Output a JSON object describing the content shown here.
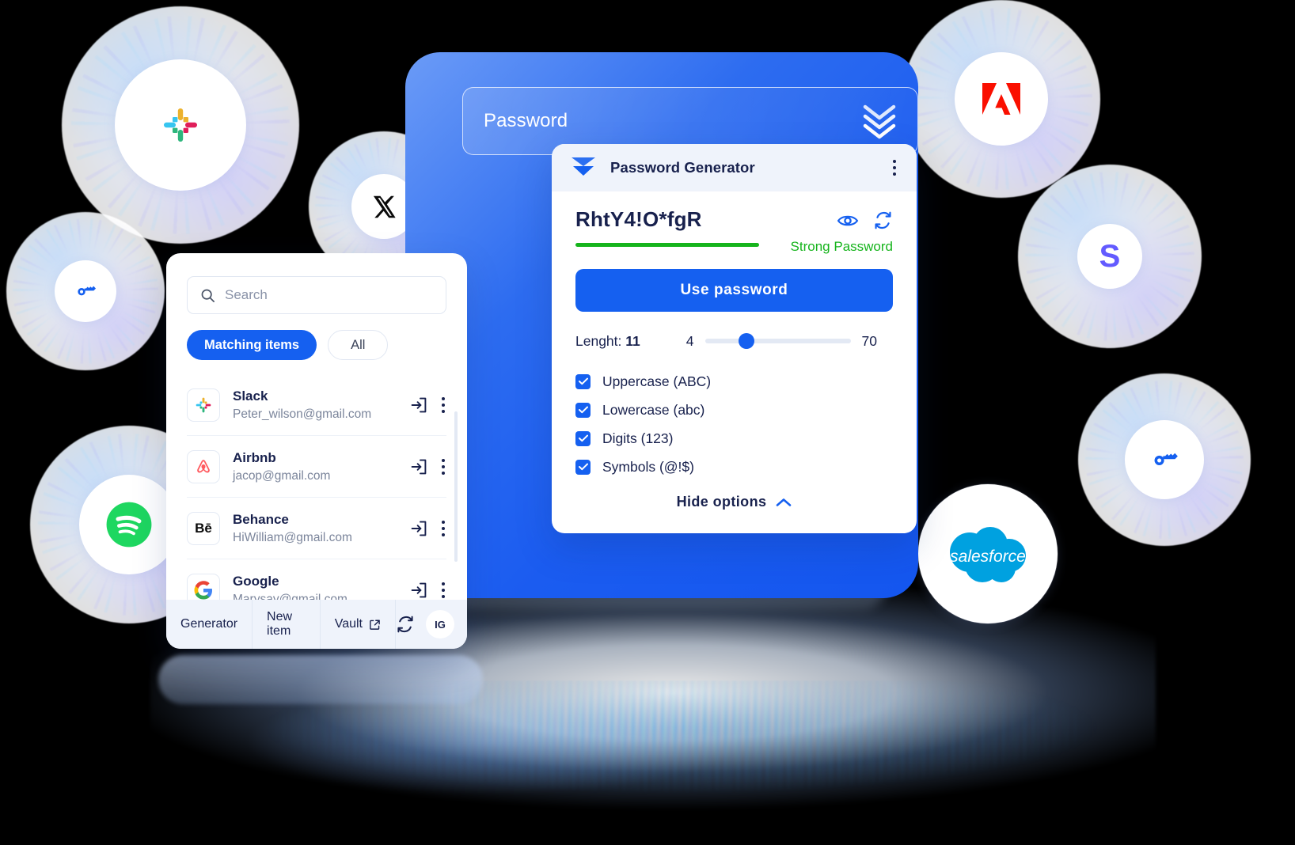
{
  "blue_card": {
    "password_field": {
      "label": "Password",
      "icon": "chevron-double-down-icon"
    }
  },
  "generator": {
    "header": {
      "title": "Password Generator",
      "logo_icon": "chevron-double-down-icon",
      "menu_icon": "kebab-menu-icon"
    },
    "password_value": "RhtY4!O*fgR",
    "strength_label": "Strong Password",
    "strength_color": "#16b41c",
    "reveal_icon": "eye-icon",
    "regenerate_icon": "refresh-icon",
    "use_password_label": "Use  password",
    "length": {
      "label": "Lenght:",
      "value": "11",
      "min": "4",
      "max": "70"
    },
    "options": [
      {
        "label": "Uppercase (ABC)",
        "checked": true
      },
      {
        "label": "Lowercase (abc)",
        "checked": true
      },
      {
        "label": "Digits (123)",
        "checked": true
      },
      {
        "label": "Symbols (@!$)",
        "checked": true
      }
    ],
    "hide_options_label": "Hide  options",
    "hide_options_icon": "chevron-up-icon"
  },
  "vault": {
    "search": {
      "placeholder": "Search",
      "icon": "search-icon"
    },
    "filters": [
      {
        "label": "Matching items",
        "active": true
      },
      {
        "label": "All",
        "active": false
      }
    ],
    "items": [
      {
        "title": "Slack",
        "account": "Peter_wilson@gmail.com",
        "logo": "slack-logo",
        "fill_icon": "autofill-icon",
        "menu_icon": "kebab-menu-icon"
      },
      {
        "title": "Airbnb",
        "account": "jacop@gmail.com",
        "logo": "airbnb-logo",
        "fill_icon": "autofill-icon",
        "menu_icon": "kebab-menu-icon"
      },
      {
        "title": "Behance",
        "account": "HiWilliam@gmail.com",
        "logo": "behance-logo",
        "fill_icon": "autofill-icon",
        "menu_icon": "kebab-menu-icon"
      },
      {
        "title": "Google",
        "account": "Marysay@gmail.com",
        "logo": "google-logo",
        "fill_icon": "autofill-icon",
        "menu_icon": "kebab-menu-icon"
      }
    ],
    "bottom_bar": {
      "generator_label": "Generator",
      "new_item_label": "New item",
      "vault_label": "Vault",
      "vault_icon": "external-link-icon",
      "sync_icon": "refresh-icon",
      "avatar_initials": "IG"
    }
  },
  "brand_badges": [
    {
      "name": "slack",
      "label": "Slack"
    },
    {
      "name": "x",
      "label": "X"
    },
    {
      "name": "key-left",
      "label": "Key"
    },
    {
      "name": "spotify",
      "label": "Spotify"
    },
    {
      "name": "adobe",
      "label": "Adobe"
    },
    {
      "name": "stripe",
      "label": "S"
    },
    {
      "name": "key-right",
      "label": "Key"
    },
    {
      "name": "salesforce",
      "label": "salesforce"
    }
  ],
  "colors": {
    "accent_blue": "#1560f0",
    "card_blue": "#1b5cf0",
    "dark_navy": "#18214d",
    "strong_green": "#16b41c",
    "salesforce_blue": "#00a1e0",
    "spotify_green": "#1ed760",
    "adobe_red": "#fa0f00",
    "stripe_purple": "#635bff",
    "airbnb_red": "#ff5a5f"
  }
}
